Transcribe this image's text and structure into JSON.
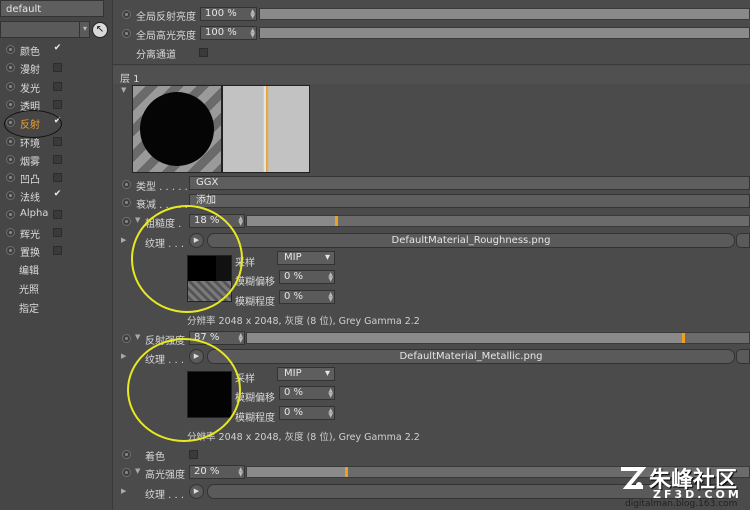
{
  "material": {
    "name": "default"
  },
  "channels": [
    {
      "label": "颜色",
      "checked": true
    },
    {
      "label": "漫射",
      "checked": false
    },
    {
      "label": "发光",
      "checked": false
    },
    {
      "label": "透明",
      "checked": false
    },
    {
      "label": "反射",
      "checked": true,
      "active": true
    },
    {
      "label": "环境",
      "checked": false
    },
    {
      "label": "烟雾",
      "checked": false
    },
    {
      "label": "凹凸",
      "checked": false
    },
    {
      "label": "法线",
      "checked": true
    },
    {
      "label": "Alpha",
      "checked": false
    },
    {
      "label": "辉光",
      "checked": false
    },
    {
      "label": "置换",
      "checked": false
    }
  ],
  "extra_items": [
    "编辑",
    "光照",
    "指定"
  ],
  "global": {
    "reflection_label": "全局反射亮度",
    "reflection_value": "100 %",
    "specular_label": "全局高光亮度",
    "specular_value": "100 %",
    "separate_label": "分离通道"
  },
  "layer": {
    "title": "层 1"
  },
  "type": {
    "label": "类型",
    "value": "GGX"
  },
  "attenuation": {
    "label": "衰减",
    "value": "添加"
  },
  "roughness": {
    "label": "粗糙度",
    "value": "18 %",
    "level": 0.18,
    "texture_label": "纹理",
    "texture_file": "DefaultMaterial_Roughness.png",
    "sampling_label": "采样",
    "sampling_value": "MIP",
    "blur_offset_label": "模糊偏移",
    "blur_offset_value": "0 %",
    "blur_degree_label": "模糊程度",
    "blur_degree_value": "0 %",
    "info": "分辨率 2048 x 2048, 灰度 (8 位), Grey Gamma 2.2"
  },
  "reflection_strength": {
    "label": "反射强度",
    "value": "87 %",
    "level": 0.87,
    "texture_label": "纹理",
    "texture_file": "DefaultMaterial_Metallic.png",
    "sampling_label": "采样",
    "sampling_value": "MIP",
    "blur_offset_label": "模糊偏移",
    "blur_offset_value": "0 %",
    "blur_degree_label": "模糊程度",
    "blur_degree_value": "0 %",
    "info": "分辨率 2048 x 2048, 灰度 (8 位), Grey Gamma 2.2"
  },
  "coloring": {
    "label": "着色"
  },
  "specular_strength": {
    "label": "高光强度",
    "value": "20 %",
    "level": 0.2,
    "texture_label": "纹理"
  },
  "watermark": {
    "brand": "朱峰社区",
    "site": "ZF3D.COM",
    "blog": "digitalman.blog.163.com"
  },
  "colors": {
    "accent": "#f0a020",
    "highlight_ellipse": "#e8e820",
    "panel": "#4b4b4b"
  }
}
